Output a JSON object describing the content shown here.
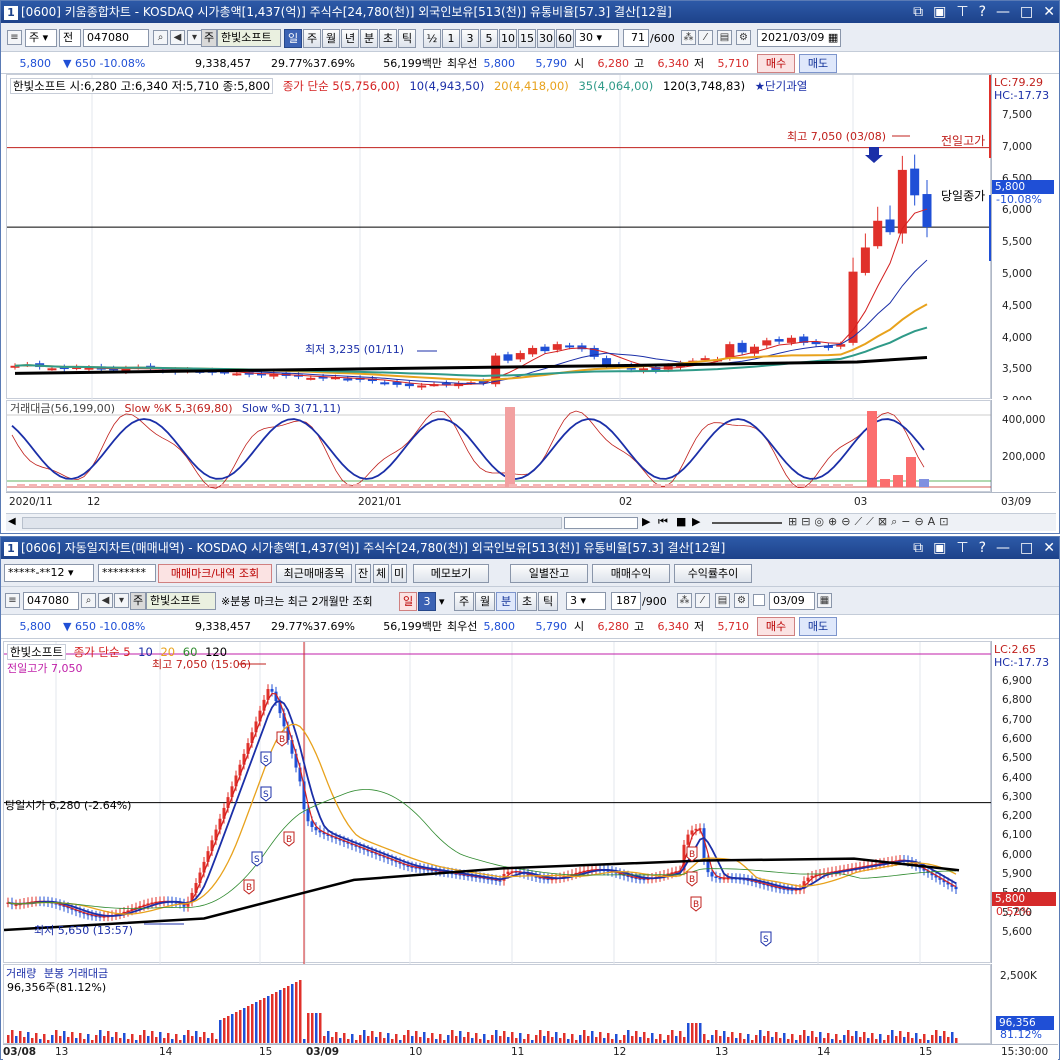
{
  "colors": {
    "up": "#e0302a",
    "down": "#1f4fd6",
    "ma5": "#d42020",
    "ma10": "#1b2fa8",
    "ma20": "#e8a21c",
    "ma35": "#2f9a88",
    "ma120": "#000000",
    "title": "#1d428a"
  },
  "top": {
    "title": "[0600] 키움종합차트 - KOSDAQ 시가총액[1,437(억)] 주식수[24,780(천)] 외국인보유[513(천)] 유통비율[57.3] 결산[12월]",
    "toolbar": {
      "period_labels": [
        "일",
        "주",
        "월",
        "년",
        "분",
        "초",
        "틱"
      ],
      "stock_type": "주",
      "adj": "전",
      "code": "047080",
      "name_badge": "주",
      "name": "한빛소프트",
      "count_options": [
        "½",
        "1",
        "3",
        "5",
        "10",
        "15",
        "30",
        "60"
      ],
      "count_value": "30",
      "range": "71",
      "range_max": "/600",
      "date": "2021/03/09"
    },
    "quote": {
      "price": "5,800",
      "change": "▼   650 -10.08%",
      "volume": "9,338,457",
      "rate1": "29.77%",
      "rate2": "37.69%",
      "amount": "56,199백만",
      "best_label": "최우선",
      "best1": "5,800",
      "best2": "5,790",
      "open_label": "시",
      "open": "6,280",
      "high_label": "고",
      "high": "6,340",
      "low_label": "저",
      "low": "5,710",
      "buy": "매수",
      "sell": "매도"
    },
    "legend": {
      "stock": "한빛소프트 시:6,280 고:6,340 저:5,710 종:5,800",
      "ma_title": "종가 단순 5(5,756,00)",
      "ma10": "10(4,943,50)",
      "ma20": "20(4,418,00)",
      "ma35": "35(4,064,00)",
      "ma120": "120(3,748,83)",
      "signal": "★단기과열"
    },
    "annotations": {
      "high": "최고 7,050 (03/08)",
      "low": "최저 3,235 (01/11)",
      "prev_high": "전일고가",
      "today_close": "당일종가"
    },
    "price_axis": [
      "7,500",
      "7,000",
      "6,500",
      "6,000",
      "5,500",
      "5,000",
      "4,500",
      "4,000",
      "3,500",
      "3,000"
    ],
    "lc": "LC:79.29",
    "hc": "HC:-17.73",
    "price_tag": "5,800",
    "price_tag_pct": "-10.08%",
    "sub_legend": {
      "amount": "거래대금(56,199,00)",
      "k": "Slow %K 5,3(69,80)",
      "d": "Slow %D 3(71,11)"
    },
    "sub_axis": [
      "400,000",
      "200,000"
    ],
    "dates": [
      "2020/11",
      "12",
      "2021/01",
      "02",
      "03"
    ],
    "date_right": "03/09"
  },
  "bottom": {
    "title": "[0606] 자동일지차트(매매내역) - KOSDAQ 시가총액[1,437(억)] 주식수[24,780(천)] 외국인보유[513(천)] 유통비율[57.3] 결산[12월]",
    "row1": {
      "account": "*****-**12",
      "password": "********",
      "mark_btn": "매매마크/내역 조회",
      "recent_btn": "최근매매종목",
      "jan": "잔",
      "che": "체",
      "mi": "미",
      "memo": "메모보기",
      "daily": "일별잔고",
      "profit": "매매수익",
      "trend": "수익률추이"
    },
    "row2": {
      "code": "047080",
      "name_badge": "주",
      "name": "한빛소프트",
      "note": "※분봉 마크는 최근 2개월만 조회",
      "day": "일",
      "day_num": "3",
      "period_labels": [
        "주",
        "월",
        "분",
        "초",
        "틱"
      ],
      "minute": "3",
      "range": "187",
      "range_max": "/900",
      "date": "03/09"
    },
    "quote": {
      "price": "5,800",
      "change": "▼   650 -10.08%",
      "volume": "9,338,457",
      "rate1": "29.77%",
      "rate2": "37.69%",
      "amount": "56,199백만",
      "best_label": "최우선",
      "best1": "5,800",
      "best2": "5,790",
      "open_label": "시",
      "open": "6,280",
      "high_label": "고",
      "high": "6,340",
      "low_label": "저",
      "low": "5,710",
      "buy": "매수",
      "sell": "매도"
    },
    "legend": {
      "stock": "한빛소프트",
      "ma_title": "종가 단순 5",
      "ma10": "10",
      "ma20": "20",
      "ma60": "60",
      "ma120": "120"
    },
    "annotations": {
      "prev_high": "전일고가 7,050",
      "high": "최고 7,050 (15:06)",
      "open_line": "당일시가 6,280 (-2.64%)",
      "low": "최저 5,650 (13:57)"
    },
    "price_axis": [
      "6,900",
      "6,800",
      "6,700",
      "6,600",
      "6,500",
      "6,400",
      "6,300",
      "6,200",
      "6,100",
      "6,000",
      "5,900",
      "5,800",
      "5,700",
      "5,600"
    ],
    "lc": "LC:2.65",
    "hc": "HC:-17.73",
    "price_tag": "5,800",
    "price_tag_pct": "0.52%",
    "sub_legend": {
      "vol": "거래량",
      "amt": "분봉 거래대금",
      "value": "96,356주(81.12%)"
    },
    "sub_axis": [
      "2,500K"
    ],
    "vol_tag": "96,356",
    "vol_tag_pct": "81.12%",
    "dates": [
      "03/08",
      "13",
      "14",
      "15",
      "03/09",
      "10",
      "11",
      "12",
      "13",
      "14",
      "15"
    ],
    "time_right": "15:30:00"
  }
}
